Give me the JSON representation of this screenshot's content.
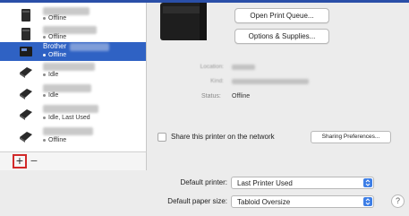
{
  "printers": [
    {
      "name": "",
      "status": "Offline",
      "selected": false,
      "icon": "laser-printer-icon"
    },
    {
      "name": "",
      "status": "Offline",
      "selected": false,
      "icon": "laser-printer-icon"
    },
    {
      "name": "Brother",
      "status": "Offline",
      "selected": true,
      "icon": "label-printer-icon"
    },
    {
      "name": "",
      "status": "Idle",
      "selected": false,
      "icon": "label-printer-icon"
    },
    {
      "name": "",
      "status": "Idle",
      "selected": false,
      "icon": "label-printer-icon"
    },
    {
      "name": "",
      "status": "Idle, Last Used",
      "selected": false,
      "icon": "label-printer-icon"
    },
    {
      "name": "",
      "status": "Offline",
      "selected": false,
      "icon": "label-printer-icon"
    }
  ],
  "list_controls": {
    "add": "+",
    "remove": "−"
  },
  "detail": {
    "open_queue": "Open Print Queue...",
    "options_supplies": "Options & Supplies...",
    "location_label": "Location:",
    "kind_label": "Kind:",
    "status_label": "Status:",
    "status_value": "Offline"
  },
  "sharing": {
    "checkbox_label": "Share this printer on the network",
    "checked": false,
    "preferences_button": "Sharing Preferences..."
  },
  "defaults": {
    "printer_label": "Default printer:",
    "printer_value": "Last Printer Used",
    "paper_label": "Default paper size:",
    "paper_value": "Tabloid Oversize"
  },
  "help": "?",
  "colors": {
    "selection": "#2f62c4",
    "highlight_box": "#d22a2a",
    "popup_accent": "#3d7ee6"
  }
}
